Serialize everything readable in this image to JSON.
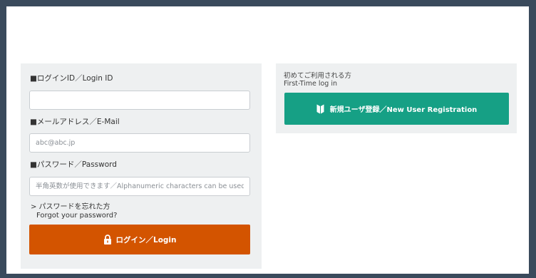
{
  "login": {
    "login_id": {
      "label": "■ログインID／Login ID",
      "value": "",
      "placeholder": ""
    },
    "email": {
      "label": "■メールアドレス／E-Mail",
      "value": "",
      "placeholder": "abc@abc.jp"
    },
    "password": {
      "label": "■パスワード／Password",
      "value": "",
      "placeholder": "半角英数が使用できます／Alphanumeric characters can be used."
    },
    "forgot_line1": "> パスワードを忘れた方",
    "forgot_line2": "Forgot your password?",
    "button_label": "ログイン／Login",
    "button_color": "#d35400",
    "button_icon": "lock-icon"
  },
  "registration": {
    "title_line1": "初めてご利用される方",
    "title_line2": "First-Time log in",
    "button_label": "新規ユーザ登録／New User Registration",
    "button_color": "#16a085",
    "button_icon": "beginner-mark-icon"
  },
  "colors": {
    "outer_border": "#3a4a5c",
    "panel_background": "#eef0f1"
  }
}
